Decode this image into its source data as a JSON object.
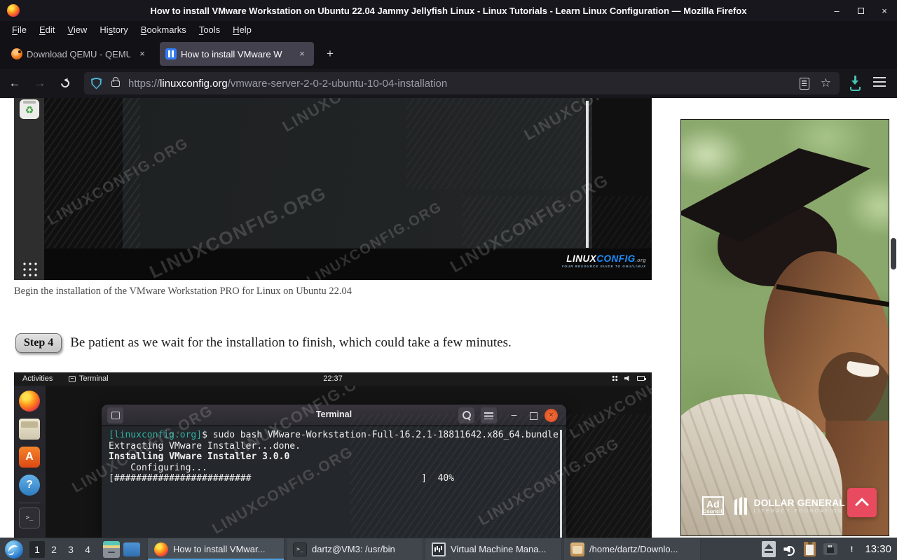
{
  "watermark": {
    "text": "LINUXCONFIG.ORG"
  },
  "titlebar": {
    "title": "How to install VMware Workstation on Ubuntu 22.04 Jammy Jellyfish Linux - Linux Tutorials - Learn Linux Configuration — Mozilla Firefox",
    "minimize": "–",
    "close": "×"
  },
  "menubar": {
    "items": [
      {
        "label": "File",
        "accel": 0
      },
      {
        "label": "Edit",
        "accel": 0
      },
      {
        "label": "View",
        "accel": 0
      },
      {
        "label": "History",
        "accel": 2
      },
      {
        "label": "Bookmarks",
        "accel": 0
      },
      {
        "label": "Tools",
        "accel": 0
      },
      {
        "label": "Help",
        "accel": 0
      }
    ]
  },
  "tabbar": {
    "tabs": [
      {
        "label": "Download QEMU - QEMU",
        "close": "×"
      },
      {
        "label": "How to install VMware W",
        "close": "×"
      }
    ],
    "new_tab": "+"
  },
  "navbar": {
    "back": "←",
    "forward": "→",
    "url": {
      "scheme": "https://",
      "domain": "linuxconfig.org",
      "path": "/vmware-server-2-0-2-ubuntu-10-04-installation"
    },
    "star": "☆"
  },
  "page": {
    "caption": "Begin the installation of the VMware Workstation PRO for Linux on Ubuntu 22.04",
    "step": {
      "badge": "Step 4",
      "text": "Be patient as we wait for the installation to finish, which could take a few minutes."
    }
  },
  "shot1": {
    "trash_glyph": "♻",
    "logo": {
      "part1": "LINUX",
      "part2": "CONFIG",
      "part3": ".org",
      "tagline": "YOUR RESOURCE GUIDE TO GNU/LINUX"
    }
  },
  "shot2": {
    "topbar": {
      "activities": "Activities",
      "app_name": "Terminal",
      "clock": "22:37"
    },
    "terminal": {
      "title": "Terminal",
      "minimize": "–",
      "close": "×",
      "lines": [
        {
          "prompt": "[linuxconfig.org]",
          "text": "$ sudo bash VMware-Workstation-Full-16.2.1-18811642.x86_64.bundle"
        },
        {
          "text": "Extracting VMware Installer...done."
        },
        {
          "text": "Installing VMware Installer 3.0.0",
          "bold": true
        },
        {
          "text": "    Configuring..."
        },
        {
          "text": "[#########################                               ]  40%"
        }
      ]
    }
  },
  "ad": {
    "council_top": "Ad",
    "council_bottom": "Council",
    "brand_line1": "DOLLAR GENERAL",
    "brand_line2": "LITERACY FOUNDATION"
  },
  "taskbar": {
    "workspaces": [
      "1",
      "2",
      "3",
      "4"
    ],
    "active_workspace": "1",
    "tasks": [
      {
        "label": "How to install VMwar...",
        "icon": "firefox",
        "active": true
      },
      {
        "label": "dartz@VM3: /usr/bin",
        "icon": "terminal",
        "active": false
      },
      {
        "label": "Virtual Machine Mana...",
        "icon": "vmm",
        "active": false
      },
      {
        "label": "/home/dartz/Downlo...",
        "icon": "files",
        "active": false
      }
    ],
    "clock": "13:30"
  }
}
